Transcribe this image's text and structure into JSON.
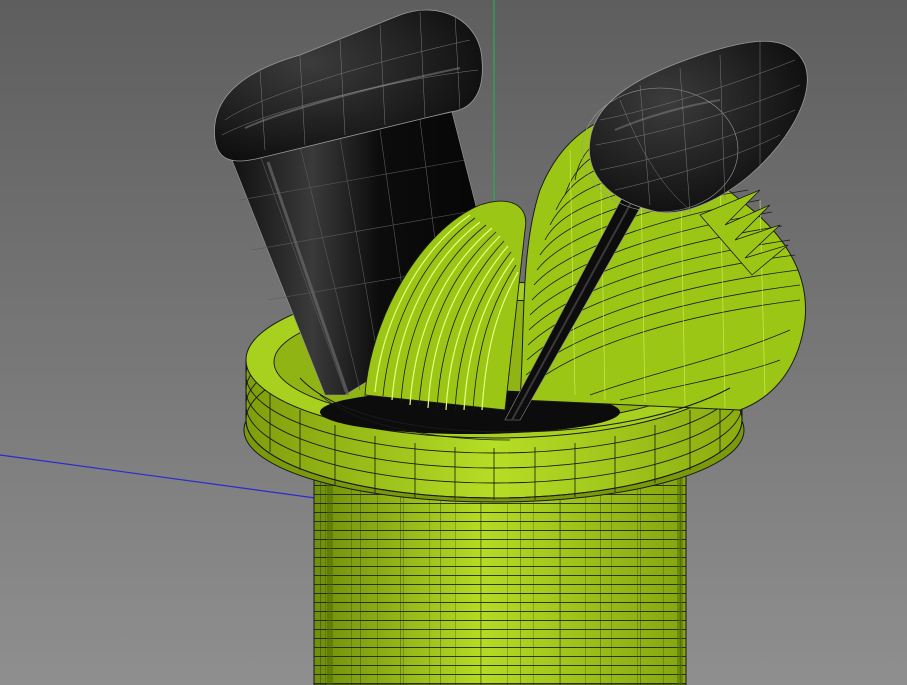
{
  "viewport": {
    "background_top": "#5e5e5e",
    "background_bottom": "#8f8f8f"
  },
  "axes": {
    "y_axis_color": "#22b14c",
    "z_axis_color": "#2a2acf"
  },
  "model": {
    "body_color": "#9bc616",
    "body_shadow": "#6f8e0a",
    "body_highlight": "#c6ea3c",
    "wire_color": "#1a1a1a",
    "rubber_color": "#0b0b0b",
    "rubber_highlight": "#5a5a5a",
    "rubber_wire": "#9a9a9a"
  }
}
